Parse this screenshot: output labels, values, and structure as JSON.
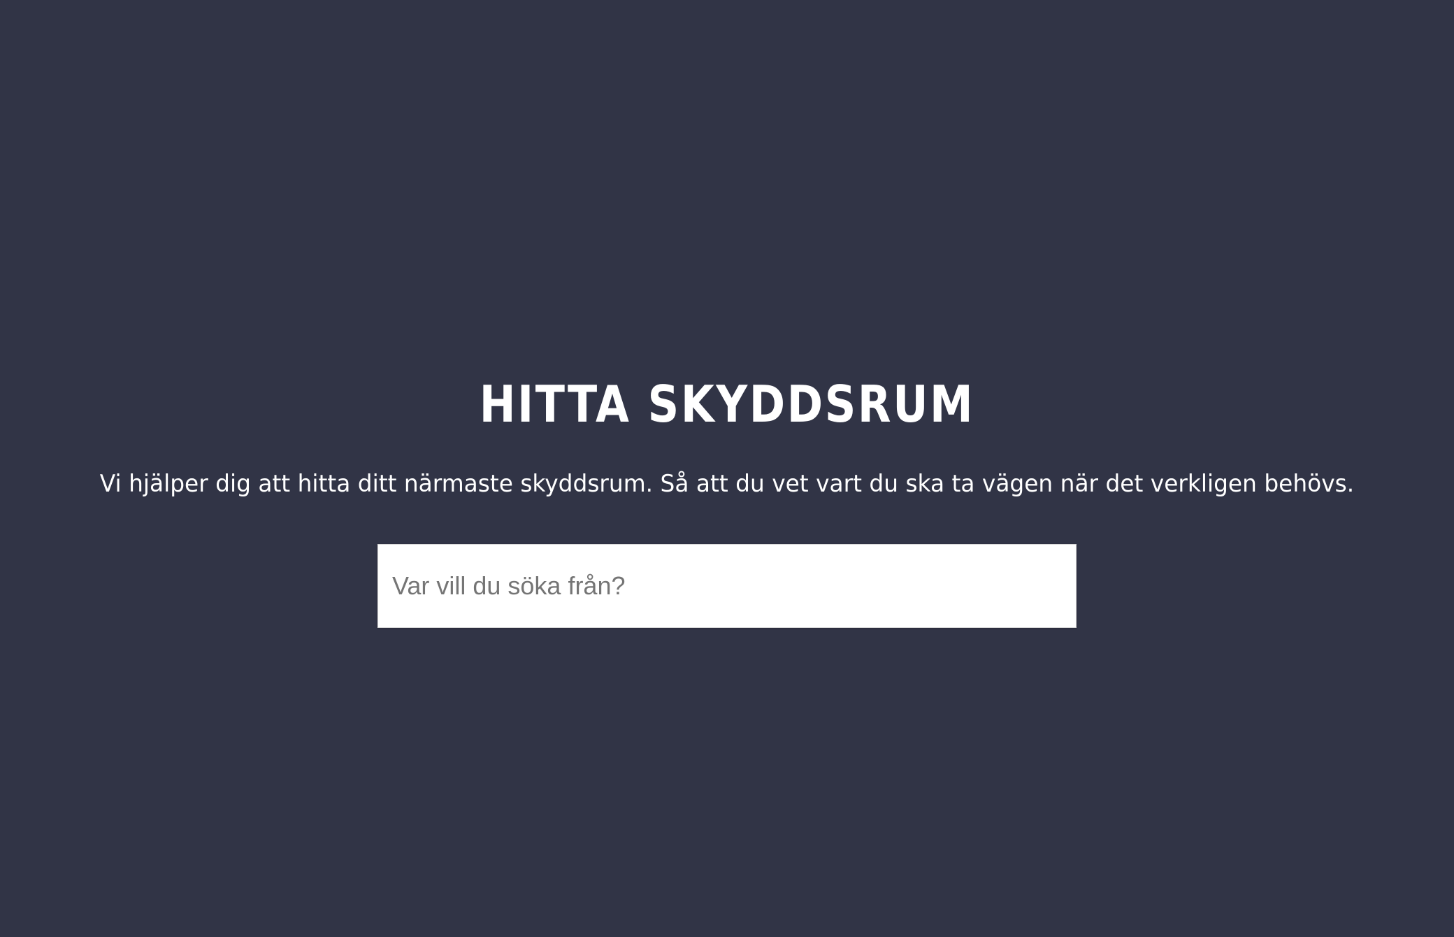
{
  "hero": {
    "title": "HITTA SKYDDSRUM",
    "subtitle": "Vi hjälper dig att hitta ditt närmaste skyddsrum. Så att du vet vart du ska ta vägen när det verkligen behövs."
  },
  "search": {
    "value": "",
    "placeholder": "Var vill du söka från?"
  },
  "colors": {
    "background": "#313446",
    "text": "#ffffff",
    "input_background": "#ffffff",
    "placeholder": "#757575"
  }
}
